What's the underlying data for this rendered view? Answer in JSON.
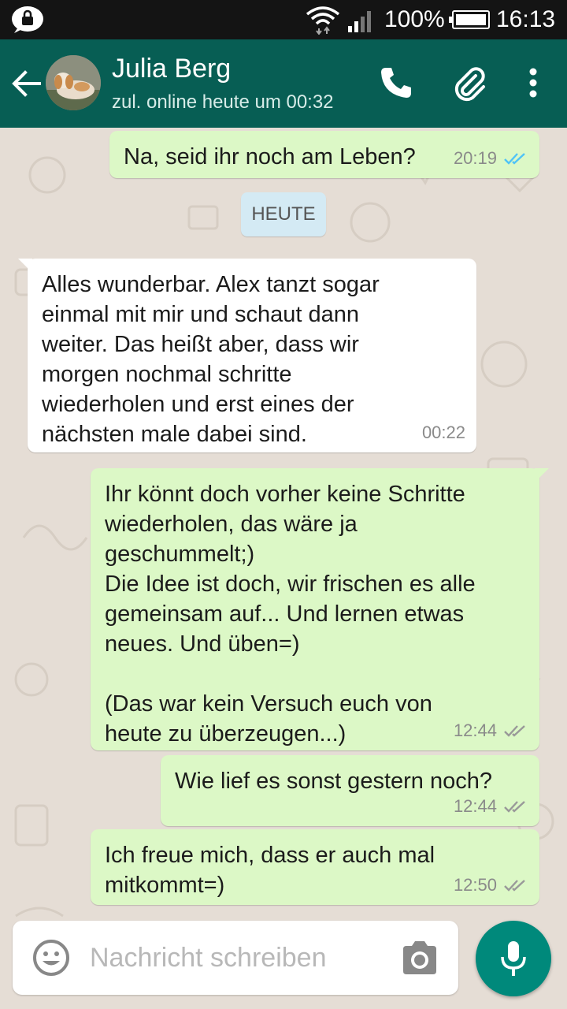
{
  "status_bar": {
    "battery_percent": "100%",
    "time": "16:13"
  },
  "header": {
    "contact_name": "Julia Berg",
    "last_seen": "zul. online heute um 00:32"
  },
  "chat": {
    "date_divider": "HEUTE",
    "messages": [
      {
        "direction": "out",
        "text": "Na, seid ihr noch am Leben?",
        "time": "20:19",
        "status": "read"
      },
      {
        "direction": "in",
        "text": "Alles wunderbar. Alex tanzt sogar\neinmal mit mir und schaut dann\nweiter. Das heißt aber, dass wir\nmorgen nochmal schritte\nwiederholen und erst eines der\nnächsten male dabei sind.",
        "time": "00:22"
      },
      {
        "direction": "out",
        "text": "Ihr könnt doch vorher keine Schritte\nwiederholen, das wäre ja\ngeschummelt;)\nDie Idee ist doch, wir frischen es alle\ngemeinsam auf... Und lernen etwas\nneues. Und üben=)\n\n(Das war kein Versuch euch von\nheute zu überzeugen...)",
        "time": "12:44",
        "status": "delivered"
      },
      {
        "direction": "out",
        "text": "Wie lief es sonst gestern noch?",
        "time": "12:44",
        "status": "delivered"
      },
      {
        "direction": "out",
        "text": "Ich freue mich, dass er auch mal\nmitkommt=)",
        "time": "12:50",
        "status": "delivered"
      }
    ]
  },
  "input": {
    "placeholder": "Nachricht schreiben"
  },
  "colors": {
    "header": "#075e54",
    "outgoing_bubble": "#dcf8c6",
    "incoming_bubble": "#ffffff",
    "read_ticks": "#4fc3f7",
    "mic_button": "#00897b"
  },
  "icons": [
    "lock-icon",
    "wifi-icon",
    "signal-icon",
    "battery-icon",
    "back-arrow-icon",
    "phone-icon",
    "paperclip-icon",
    "more-vert-icon",
    "emoji-icon",
    "camera-icon",
    "mic-icon"
  ]
}
